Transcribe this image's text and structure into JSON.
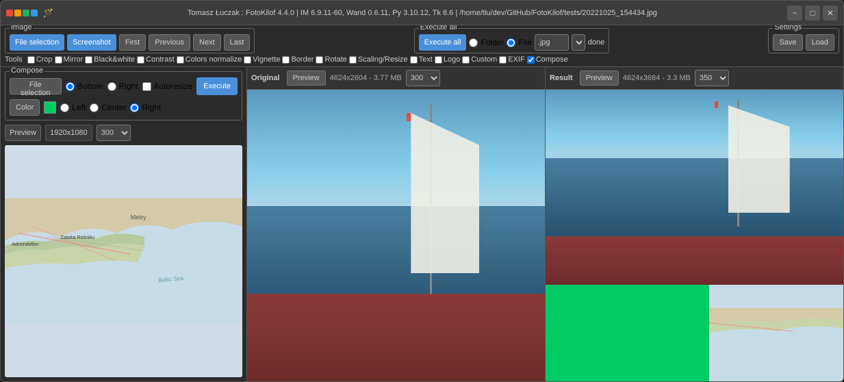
{
  "window": {
    "title": "Tomasz Łuczak : FotoKilof 4.4.0 | IM 6.9.11-60, Wand 0.6.11, Py 3.10.12, Tk 8.6 | /home/tlu/dev/GitHub/FotoKilof/tests/20221025_154434.jpg"
  },
  "image_section": {
    "label": "Image",
    "buttons": [
      "File selection",
      "Screenshot",
      "First",
      "Previous",
      "Next",
      "Last"
    ]
  },
  "execute_all": {
    "label": "Execute all",
    "execute_btn": "Execute all",
    "folder_label": "Folder",
    "file_label": "File",
    "file_ext": ".jpg",
    "done": "done"
  },
  "settings": {
    "label": "Settings",
    "save": "Save",
    "load": "Load"
  },
  "tools": {
    "label": "Tools",
    "items": [
      {
        "name": "Crop",
        "checked": false
      },
      {
        "name": "Mirror",
        "checked": false
      },
      {
        "name": "Black&white",
        "checked": false
      },
      {
        "name": "Contrast",
        "checked": false
      },
      {
        "name": "Colors normalize",
        "checked": false
      },
      {
        "name": "Vignette",
        "checked": false
      },
      {
        "name": "Border",
        "checked": false
      },
      {
        "name": "Rotate",
        "checked": false
      },
      {
        "name": "Scaling/Resize",
        "checked": false
      },
      {
        "name": "Text",
        "checked": false
      },
      {
        "name": "Logo",
        "checked": false
      },
      {
        "name": "Custom",
        "checked": false
      },
      {
        "name": "EXIF",
        "checked": false
      },
      {
        "name": "Compose",
        "checked": true
      }
    ]
  },
  "compose": {
    "label": "Compose",
    "file_selection": "File selection",
    "positions": [
      "Bottom",
      "Right"
    ],
    "autoresize": "Autoresize",
    "execute": "Execute",
    "color_btn": "Color",
    "alignments": [
      "Left",
      "Center",
      "Right"
    ],
    "preview_label": "Preview",
    "resolution": "1920x1080",
    "quality": "300"
  },
  "original_panel": {
    "title": "Original",
    "preview_btn": "Preview",
    "info": "4624x2604 - 3.77 MB",
    "quality": "300"
  },
  "result_panel": {
    "title": "Result",
    "preview_btn": "Preview",
    "info": "4624x3684 - 3.3 MB",
    "quality": "350"
  }
}
